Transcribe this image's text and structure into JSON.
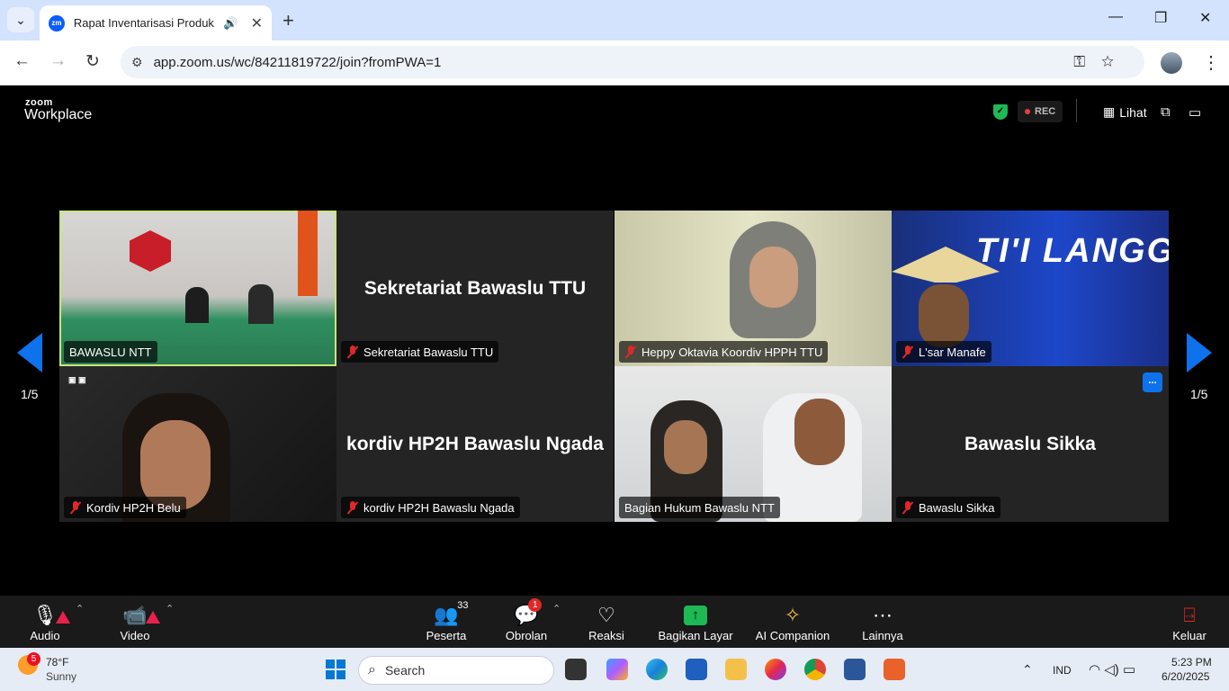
{
  "browser": {
    "tab_title": "Rapat Inventarisasi Produk Hukum",
    "favicon_text": "zm",
    "url": "app.zoom.us/wc/84211819722/join?fromPWA=1"
  },
  "zoom": {
    "logo_top": "zoom",
    "logo_main": "Workplace",
    "rec_label": "REC",
    "view_label": "Lihat",
    "page_left": "1/5",
    "page_right": "1/5",
    "more_label": "...",
    "tiles": [
      {
        "name": "BAWASLU NTT",
        "big": "",
        "muted": false
      },
      {
        "name": "Sekretariat Bawaslu TTU",
        "big": "Sekretariat Bawaslu TTU",
        "muted": true
      },
      {
        "name": "Heppy Oktavia Koordiv HPPH TTU",
        "big": "",
        "muted": true
      },
      {
        "name": "L'sar Manafe",
        "big": "",
        "muted": true
      },
      {
        "name": "Kordiv HP2H Belu",
        "big": "",
        "muted": true
      },
      {
        "name": "kordiv HP2H Bawaslu Ngada",
        "big": "kordiv HP2H Bawaslu Ngada",
        "muted": true
      },
      {
        "name": "Bagian Hukum Bawaslu NTT",
        "big": "",
        "muted": false
      },
      {
        "name": "Bawaslu Sikka",
        "big": "Bawaslu Sikka",
        "muted": true
      }
    ],
    "toolbar": {
      "audio": "Audio",
      "video": "Video",
      "participants": "Peserta",
      "participants_count": "33",
      "chat": "Obrolan",
      "chat_badge": "1",
      "reactions": "Reaksi",
      "share": "Bagikan Layar",
      "ai": "AI Companion",
      "more": "Lainnya",
      "leave": "Keluar"
    }
  },
  "taskbar": {
    "weather_badge": "5",
    "temp": "78°F",
    "condition": "Sunny",
    "search_placeholder": "Search",
    "lang": "IND",
    "time": "5:23 PM",
    "date": "6/20/2025"
  },
  "colors": {
    "accent": "#0e72ed",
    "share": "#1db954",
    "mute": "#e02828"
  }
}
